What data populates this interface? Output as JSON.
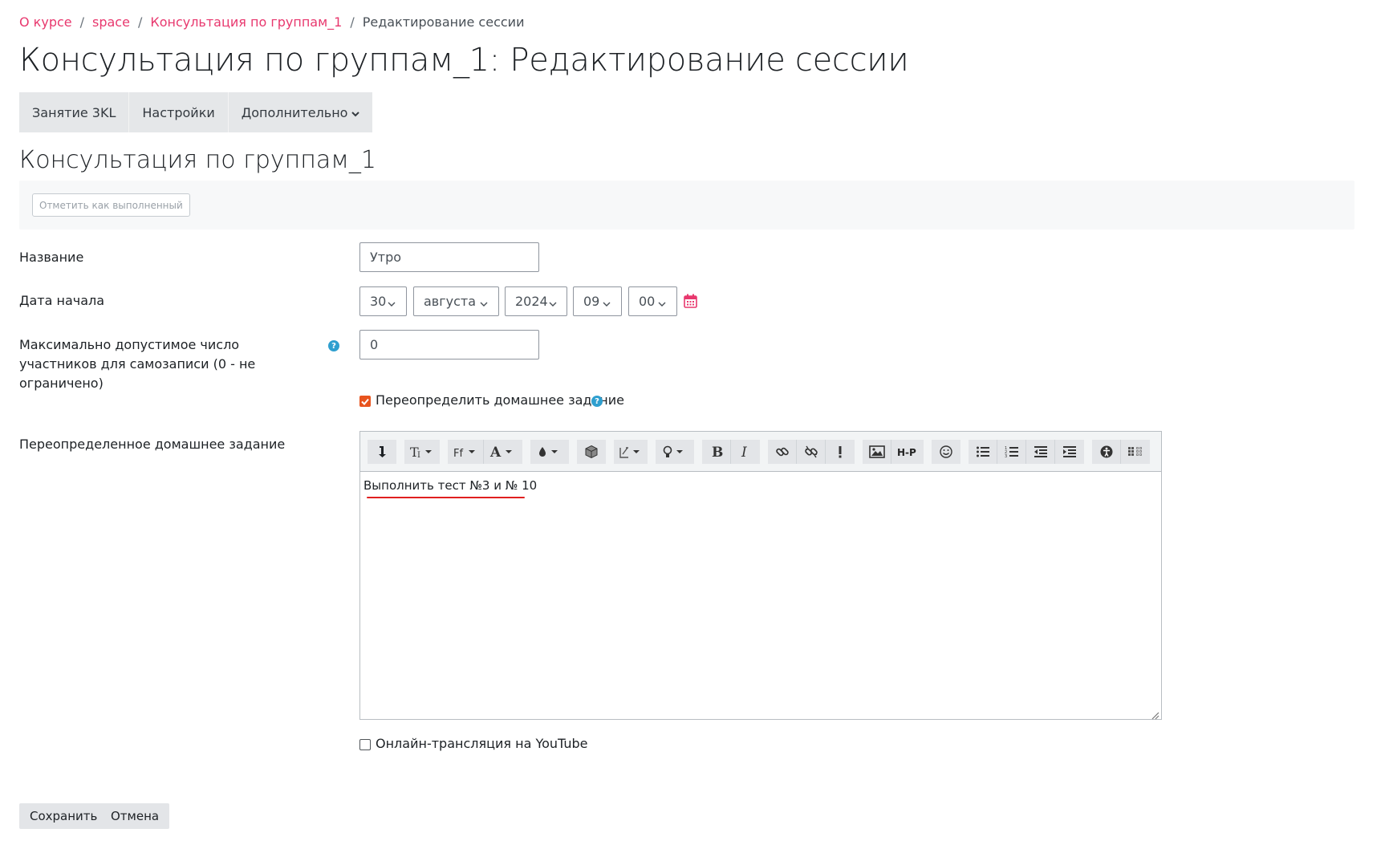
{
  "breadcrumb": {
    "items": [
      "О курсе",
      "space",
      "Консультация по группам_1"
    ],
    "current": "Редактирование сессии",
    "separator": "/"
  },
  "page_title": "Консультация по группам_1: Редактирование сессии",
  "secondary_nav": {
    "tabs": [
      "Занятие 3KL",
      "Настройки",
      "Дополнительно"
    ]
  },
  "section_title": "Консультация по группам_1",
  "completion": {
    "button_label": "Отметить как выполненный"
  },
  "form": {
    "name": {
      "label": "Название",
      "value": "Утро"
    },
    "start_date": {
      "label": "Дата начала",
      "day": "30",
      "month": "августа",
      "year": "2024",
      "hour": "09",
      "minute": "00"
    },
    "max_participants": {
      "label": "Максимально допустимое число участников для самозаписи (0 - не ограничено)",
      "value": "0"
    },
    "override_homework": {
      "label": "Переопределить домашнее задание",
      "checked": true
    },
    "overridden_homework": {
      "label": "Переопределенное домашнее задание",
      "content": "Выполнить тест №3 и № 10"
    },
    "youtube": {
      "label": "Онлайн-трансляция на YouTube",
      "checked": false
    }
  },
  "buttons": {
    "save": "Сохранить",
    "cancel": "Отмена"
  },
  "icons": {
    "help": "?",
    "calendar": "calendar-icon",
    "toolbar": [
      "collapse-icon",
      "text-style-icon",
      "font-family-icon",
      "font-color-icon",
      "background-color-icon",
      "cube-icon",
      "style-icon",
      "lightbulb-icon",
      "bold-icon",
      "italic-icon",
      "link-icon",
      "unlink-icon",
      "exclamation-icon",
      "image-icon",
      "h5p-icon",
      "emoji-icon",
      "unordered-list-icon",
      "ordered-list-icon",
      "outdent-icon",
      "indent-icon",
      "accessibility-icon",
      "screenreader-icon"
    ]
  },
  "colors": {
    "accent": "#e8386e",
    "checkbox": "#e8541e",
    "help": "#2f9fcf",
    "underline": "#e02020"
  }
}
